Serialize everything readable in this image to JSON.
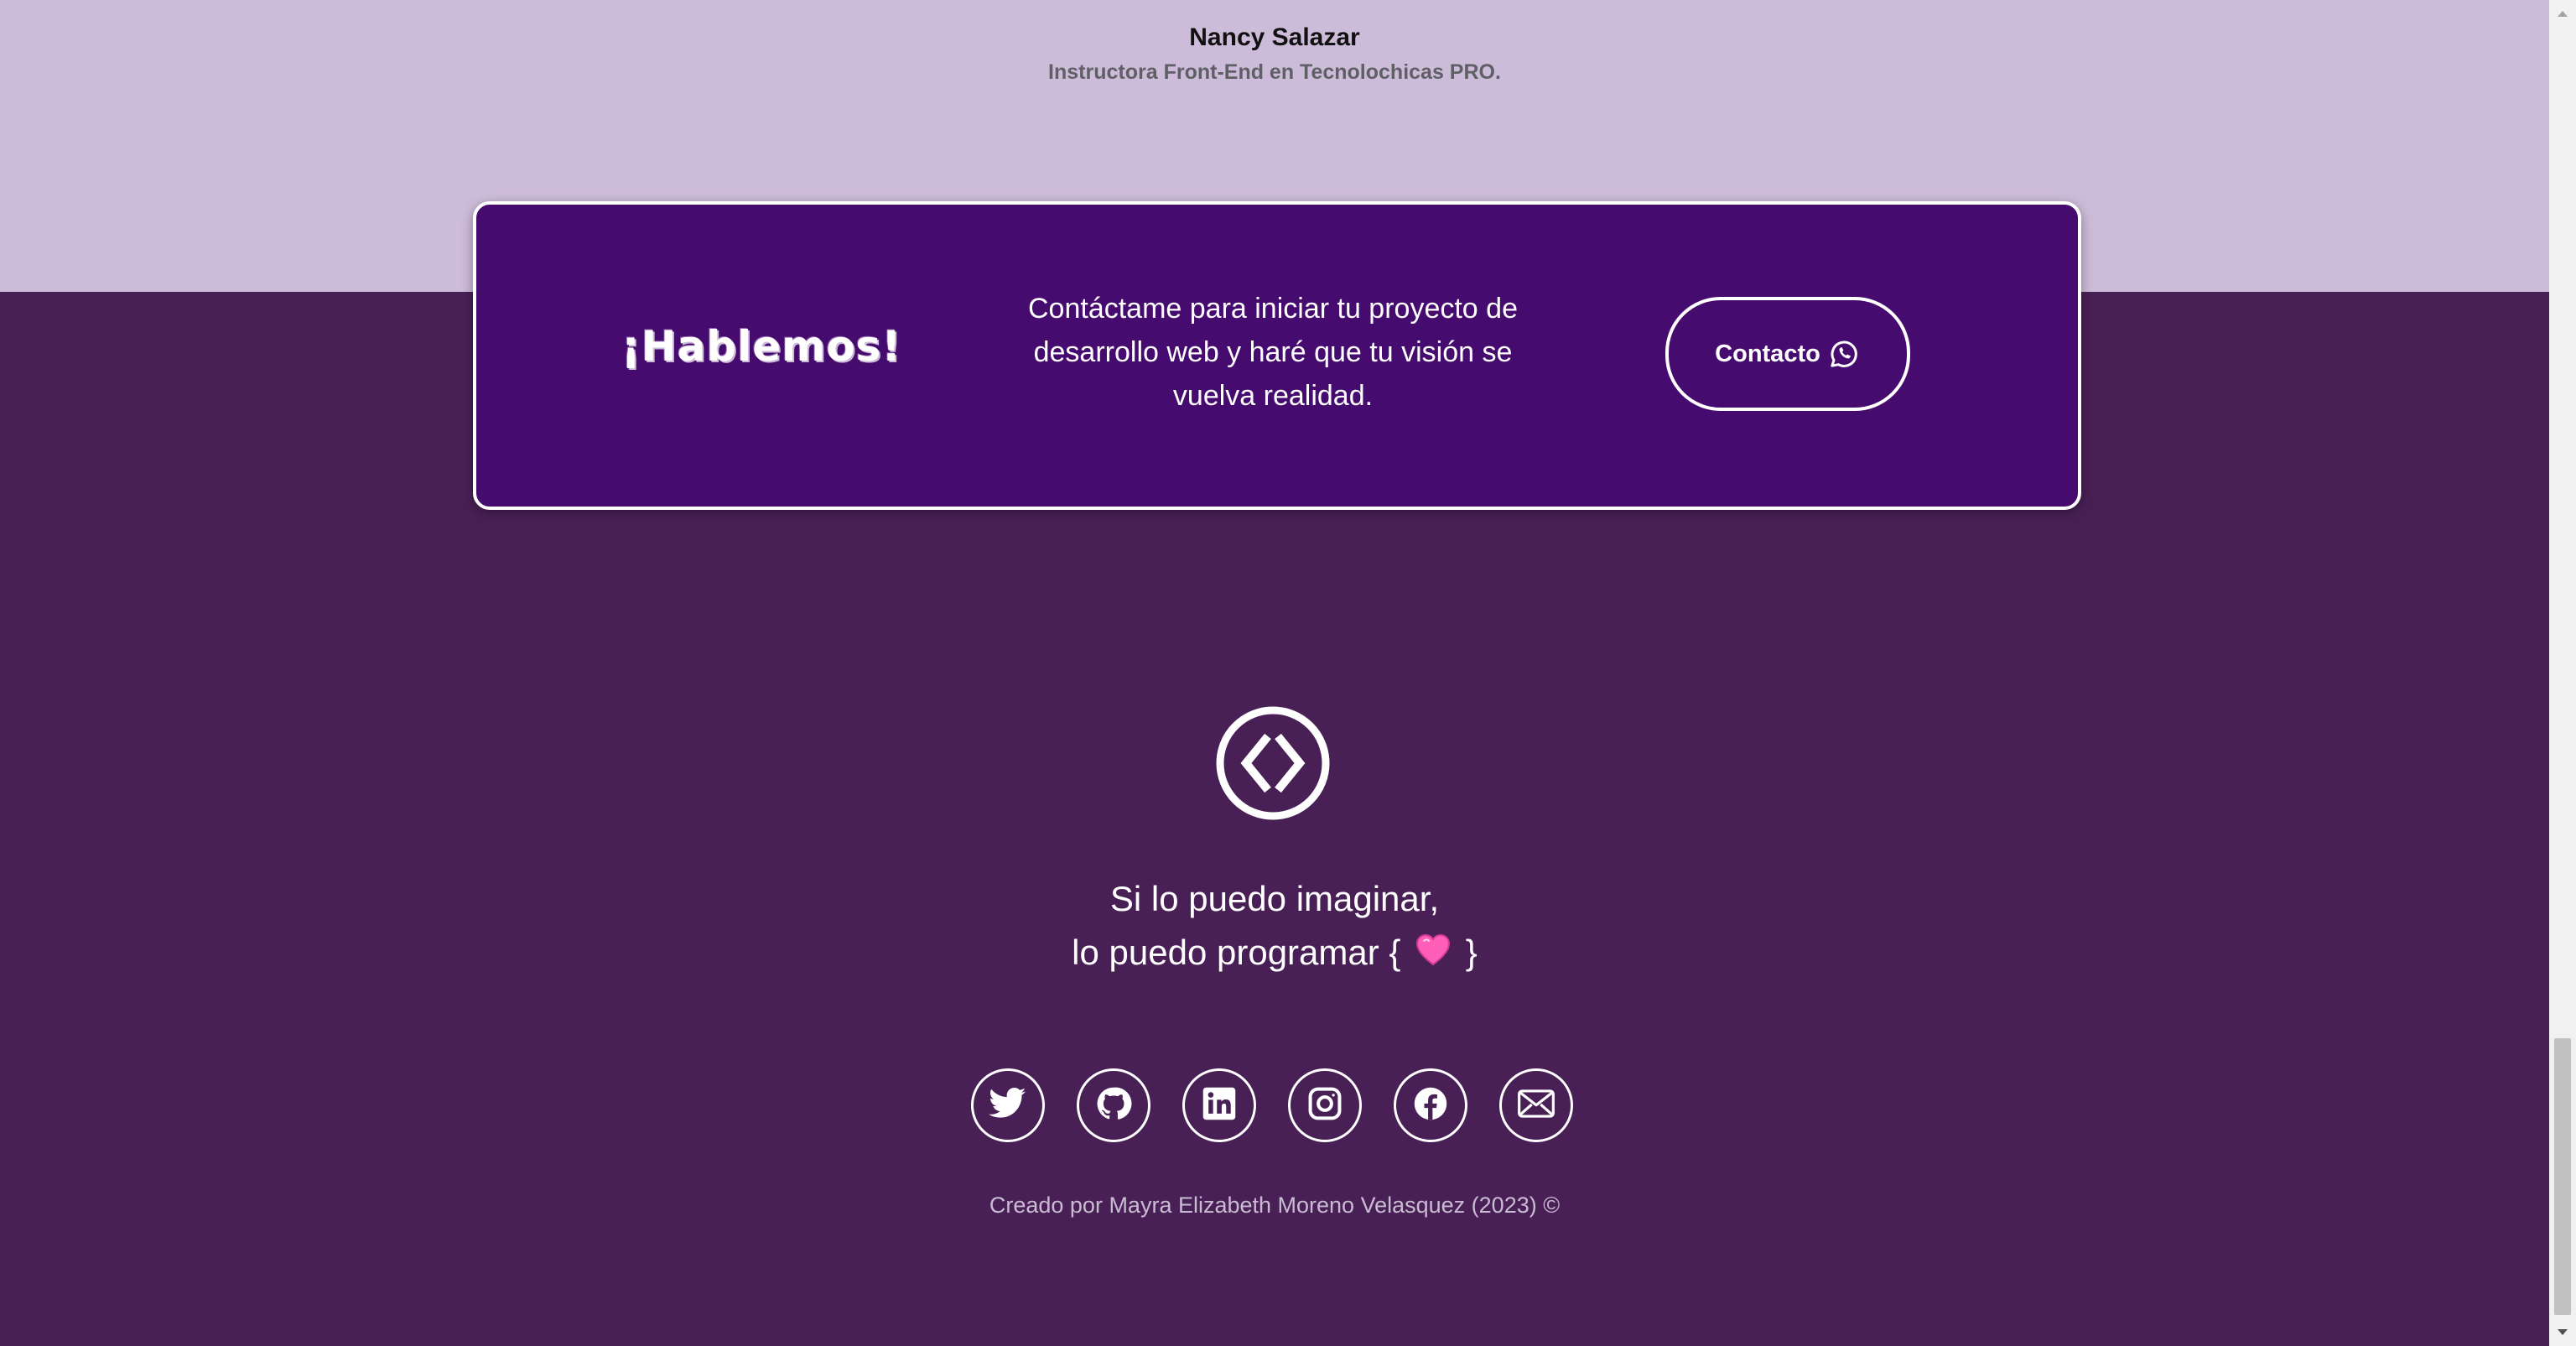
{
  "testimonial": {
    "name": "Nancy Salazar",
    "role": "Instructora Front-End en Tecnolochicas PRO."
  },
  "contact_card": {
    "title": "¡Hablemos!",
    "text": "Contáctame para iniciar tu proyecto de desarrollo web y haré que tu visión se vuelva realidad.",
    "button_label": "Contacto",
    "button_icon": "whatsapp-icon"
  },
  "footer": {
    "logo_icon": "code-brackets-icon",
    "tagline_line1": "Si lo puedo imaginar,",
    "tagline_line2_prefix": "lo puedo programar {",
    "tagline_line2_suffix": "}",
    "tagline_emoji": "pink-heart-icon",
    "social_icons": [
      "twitter-icon",
      "github-icon",
      "linkedin-icon",
      "instagram-icon",
      "facebook-icon",
      "mail-icon"
    ],
    "credits": "Creado por Mayra Elizabeth Moreno Velasquez (2023) ©"
  },
  "colors": {
    "top_band": "#cdbcd9",
    "footer_background": "#492056",
    "card_background": "#460b6e",
    "text_light": "#ffffff",
    "heart": "#ff5fb8"
  }
}
